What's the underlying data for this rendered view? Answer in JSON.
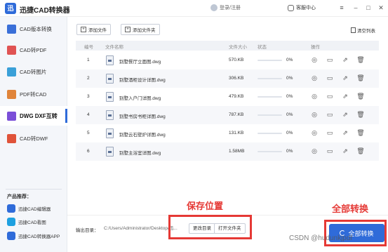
{
  "app": {
    "logo_text": "迅",
    "title": "迅捷CAD转换器",
    "login": "登录/注册",
    "service": "客服中心",
    "window_controls": [
      "minimize-icon",
      "maximize-icon",
      "close-icon"
    ]
  },
  "sidebar": {
    "items": [
      {
        "label": "CAD版本转换",
        "icon": "version-convert-icon",
        "color": "#3a6fd8",
        "active": false
      },
      {
        "label": "CAD转PDF",
        "icon": "pdf-icon",
        "color": "#e05353",
        "active": false
      },
      {
        "label": "CAD转图片",
        "icon": "image-icon",
        "color": "#3aa0d8",
        "active": false
      },
      {
        "label": "PDF转CAD",
        "icon": "pdf-to-cad-icon",
        "color": "#e0843a",
        "active": false
      },
      {
        "label": "DWG DXF互转",
        "icon": "dwg-dxf-icon",
        "color": "#7b4fd8",
        "active": true
      },
      {
        "label": "CAD转DWF",
        "icon": "dwf-icon",
        "color": "#e0533a",
        "active": false
      }
    ],
    "products_title": "产品推荐：",
    "products": [
      {
        "label": "迅捷CAD编辑器",
        "icon": "cad-editor-icon",
        "color": "#2f6bd9"
      },
      {
        "label": "迅捷CAD看图",
        "icon": "cad-viewer-icon",
        "color": "#1ea0e0"
      },
      {
        "label": "迅捷CAD转换器APP",
        "icon": "cad-app-icon",
        "color": "#2f6bd9"
      }
    ]
  },
  "toolbar": {
    "add_file": "添加文件",
    "add_folder": "添加文件夹",
    "clear_list": "清空列表"
  },
  "table": {
    "headers": {
      "index": "编号",
      "name": "文件名称",
      "size": "文件大小",
      "status": "状态",
      "actions": "操作"
    },
    "rows": [
      {
        "index": "1",
        "name": "别墅餐厅立面图.dwg",
        "size": "570.KB",
        "progress_pct": "0%"
      },
      {
        "index": "2",
        "name": "别墅酒柜设计详图.dwg",
        "size": "306.KB",
        "progress_pct": "0%"
      },
      {
        "index": "3",
        "name": "别墅入户门详图.dwg",
        "size": "479.KB",
        "progress_pct": "0%"
      },
      {
        "index": "4",
        "name": "别墅书房书柜详图.dwg",
        "size": "787.KB",
        "progress_pct": "0%"
      },
      {
        "index": "5",
        "name": "别墅云石壁炉详图.dwg",
        "size": "131.KB",
        "progress_pct": "0%"
      },
      {
        "index": "6",
        "name": "别墅主浴室详图.dwg",
        "size": "1.58MB",
        "progress_pct": "0%"
      }
    ],
    "action_icons": [
      "preview-eye-icon",
      "open-folder-icon",
      "share-export-icon",
      "delete-trash-icon"
    ]
  },
  "output": {
    "label": "输出目录：",
    "path": "C:/Users/Administrator/Desktop/迅...",
    "change_dir": "更改目录",
    "open_folder": "打开文件夹"
  },
  "convert_all": "全部转换",
  "annotations": {
    "save_location": "保存位置",
    "convert_all": "全部转换",
    "color": "#e53935"
  },
  "watermark": "CSDN @hudunkjpdf"
}
